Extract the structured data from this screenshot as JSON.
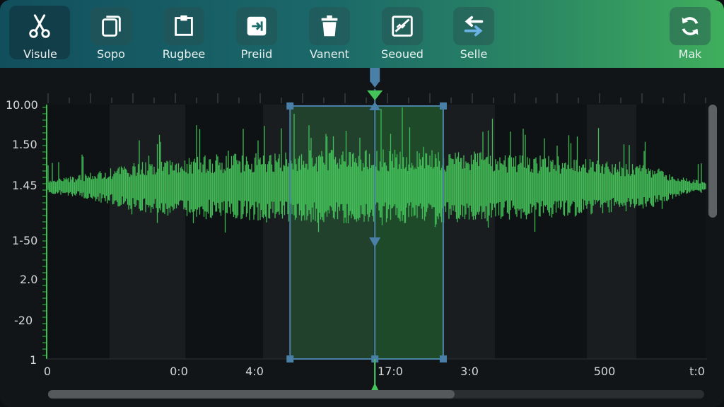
{
  "theme": {
    "accent": "#45c45a",
    "selection": "#4a7fa8",
    "toolbar_start": "#124f5e",
    "toolbar_end": "#3fae5c"
  },
  "toolbar": {
    "items": [
      {
        "label": "Visule",
        "icon": "scissors-icon"
      },
      {
        "label": "Sopo",
        "icon": "copy-icon"
      },
      {
        "label": "Rugbee",
        "icon": "paste-icon"
      },
      {
        "label": "Preiid",
        "icon": "insert-icon"
      },
      {
        "label": "Vanent",
        "icon": "trash-icon"
      },
      {
        "label": "Seoued",
        "icon": "silence-icon"
      },
      {
        "label": "Selle",
        "icon": "swap-arrows-icon"
      },
      {
        "label": "Mak",
        "icon": "loop-icon"
      }
    ]
  },
  "waveform": {
    "y_axis_labels": [
      "10.00",
      "1.50",
      "1.45",
      "1-50",
      "2.0",
      "-20",
      "1"
    ],
    "time_labels": [
      "0",
      "0:0",
      "4:0",
      "17:0",
      "3:0",
      "500",
      "t:0"
    ],
    "selection_start_fraction": 0.368,
    "selection_end_fraction": 0.601,
    "playhead_fraction": 0.497,
    "scroll_thumb_fraction": 0.62
  }
}
